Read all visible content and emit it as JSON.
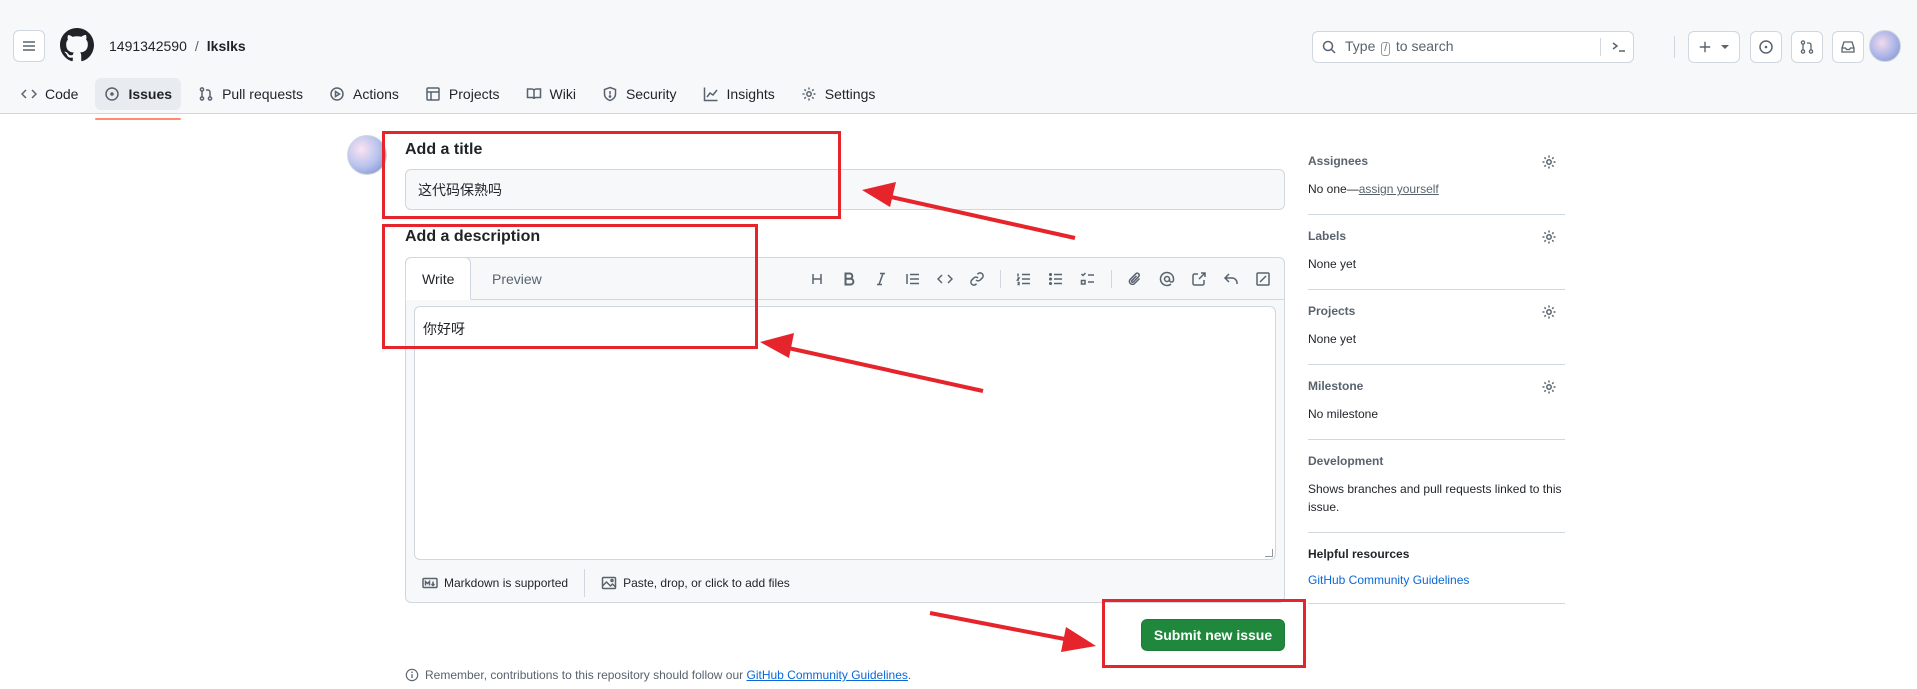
{
  "breadcrumb": {
    "owner": "1491342590",
    "separator": "/",
    "repo": "lkslks"
  },
  "search": {
    "placeholder_before": "Type",
    "placeholder_key": "/",
    "placeholder_after": "to search"
  },
  "nav_tabs": [
    {
      "label": "Code",
      "icon": "code-icon"
    },
    {
      "label": "Issues",
      "icon": "issue-opened-icon",
      "active": true
    },
    {
      "label": "Pull requests",
      "icon": "git-pull-request-icon"
    },
    {
      "label": "Actions",
      "icon": "play-icon"
    },
    {
      "label": "Projects",
      "icon": "table-icon"
    },
    {
      "label": "Wiki",
      "icon": "book-icon"
    },
    {
      "label": "Security",
      "icon": "shield-icon"
    },
    {
      "label": "Insights",
      "icon": "graph-icon"
    },
    {
      "label": "Settings",
      "icon": "gear-icon"
    }
  ],
  "form": {
    "title_label": "Add a title",
    "title_value": "这代码保熟吗",
    "description_label": "Add a description",
    "write_tab": "Write",
    "preview_tab": "Preview",
    "description_value": "你好呀",
    "markdown_note": "Markdown is supported",
    "attach_note": "Paste, drop, or click to add files",
    "submit_label": "Submit new issue",
    "remember_text": "Remember, contributions to this repository should follow our",
    "remember_link": "GitHub Community Guidelines",
    "remember_end": "."
  },
  "sidebar": {
    "assignees": {
      "title": "Assignees",
      "value_prefix": "No one—",
      "value_link": "assign yourself"
    },
    "labels": {
      "title": "Labels",
      "value": "None yet"
    },
    "projects": {
      "title": "Projects",
      "value": "None yet"
    },
    "milestone": {
      "title": "Milestone",
      "value": "No milestone"
    },
    "development": {
      "title": "Development",
      "value": "Shows branches and pull requests linked to this issue."
    },
    "helpful": {
      "title": "Helpful resources",
      "link": "GitHub Community Guidelines"
    }
  },
  "colors": {
    "annotation_red": "#e5242c",
    "submit_green": "#1f883d",
    "active_tab_underline": "#fd8c73",
    "link_blue": "#0969da"
  }
}
